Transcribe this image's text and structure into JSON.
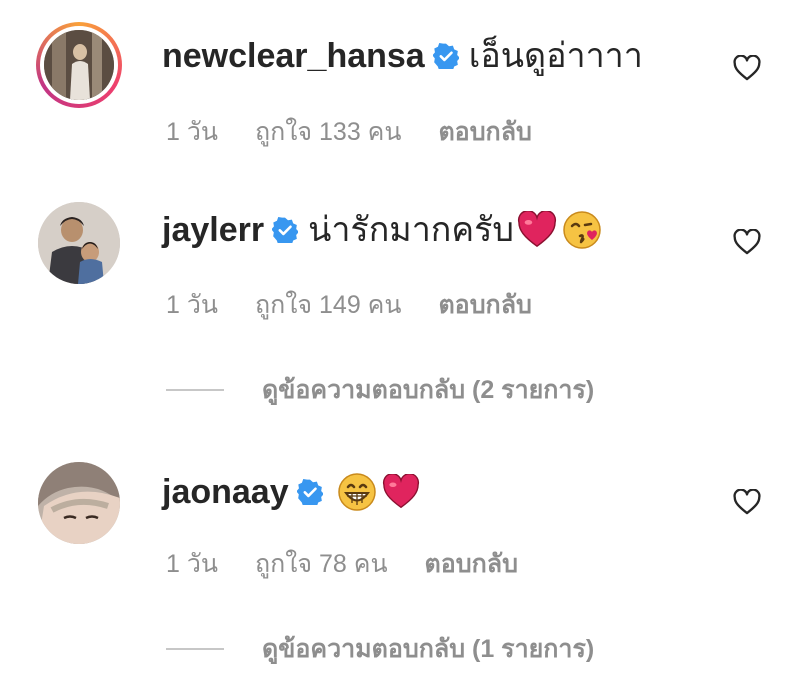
{
  "comments": [
    {
      "username": "newclear_hansa",
      "text": "เอ็นดูอ่าาาา",
      "time": "1 วัน",
      "likes": "ถูกใจ 133 คน",
      "reply_label": "ตอบกลับ",
      "verified": true,
      "story_ring": true,
      "emojis": []
    },
    {
      "username": "jaylerr",
      "text": "น่ารักมากครับ",
      "time": "1 วัน",
      "likes": "ถูกใจ 149 คน",
      "reply_label": "ตอบกลับ",
      "verified": true,
      "story_ring": false,
      "emojis": [
        "red-heart-emoji",
        "face-blowing-kiss-emoji"
      ],
      "view_replies": "ดูข้อความตอบกลับ (2 รายการ)"
    },
    {
      "username": "jaonaay",
      "text": "",
      "time": "1 วัน",
      "likes": "ถูกใจ 78 คน",
      "reply_label": "ตอบกลับ",
      "verified": true,
      "story_ring": false,
      "emojis": [
        "grinning-face-emoji",
        "red-heart-emoji"
      ],
      "view_replies": "ดูข้อความตอบกลับ (1 รายการ)"
    }
  ],
  "colors": {
    "verified_blue": "#3897f0",
    "text": "#262626",
    "secondary": "#8e8e8e",
    "heart_red": "#e0245e"
  }
}
